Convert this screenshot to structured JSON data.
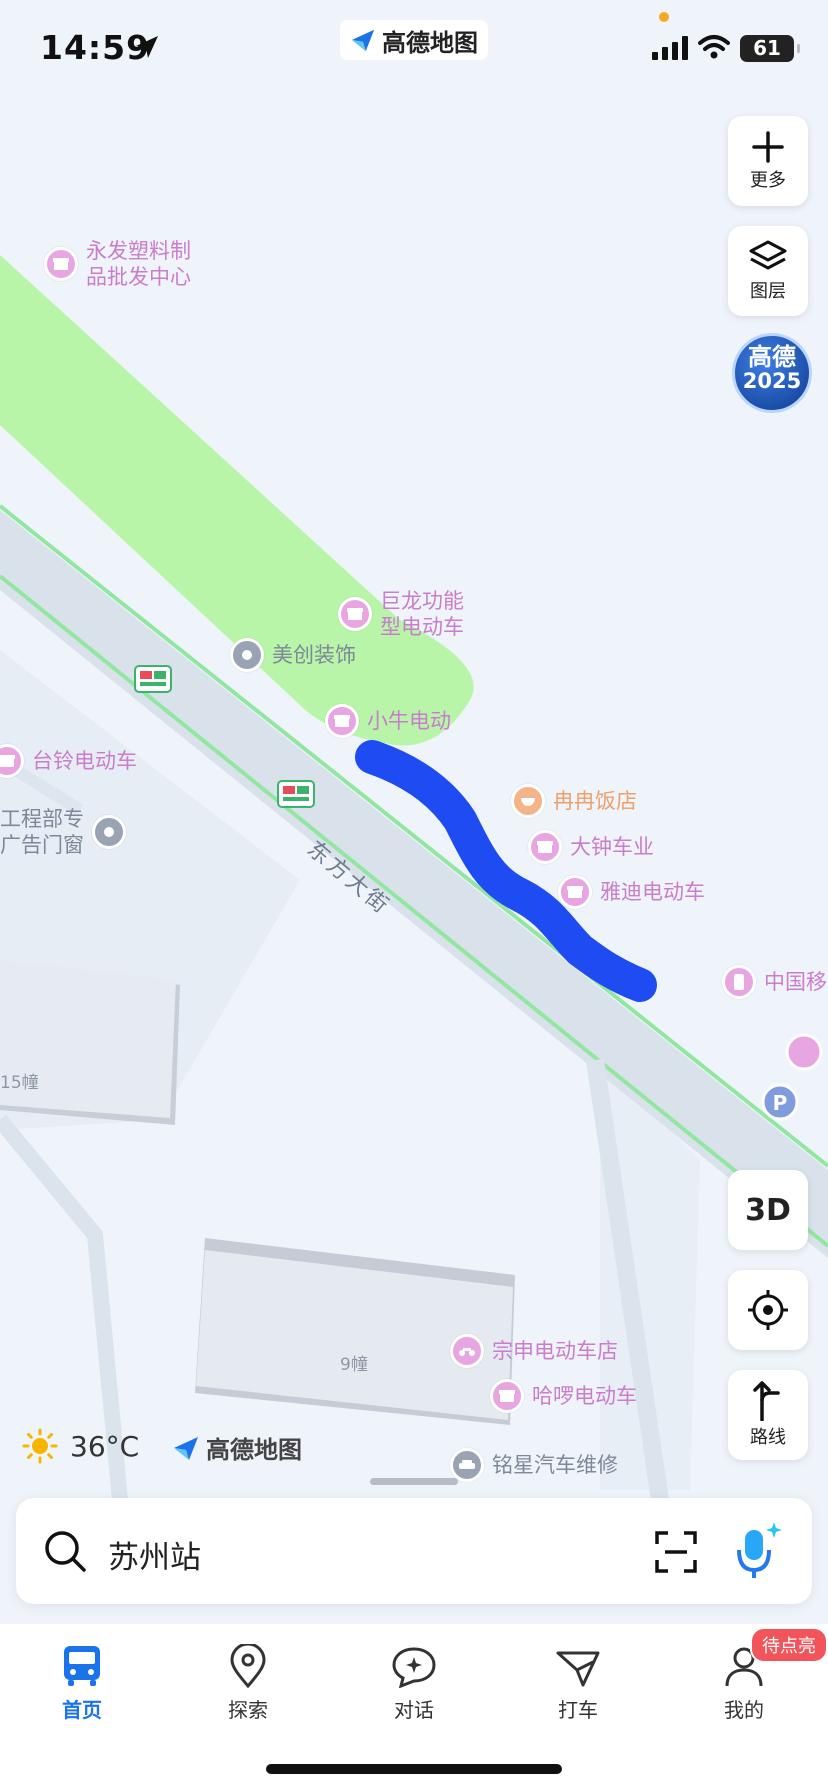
{
  "status_bar": {
    "time": "14:59",
    "battery": "61"
  },
  "header": {
    "brand": "高德地图"
  },
  "map_controls": {
    "more_label": "更多",
    "layers_label": "图层",
    "badge_line1": "高德",
    "badge_line2": "2025",
    "view_3d_label": "3D",
    "route_label": "路线"
  },
  "map": {
    "pois": [
      {
        "id": "yongfa",
        "label": "永发塑料制\n品批发中心",
        "color": "pink",
        "icon": "shop-icon"
      },
      {
        "id": "julong",
        "label": "巨龙功能\n型电动车",
        "color": "pink",
        "icon": "shop-icon"
      },
      {
        "id": "meichuang",
        "label": "美创装饰",
        "color": "slate",
        "icon": "place-icon"
      },
      {
        "id": "xiaoniu",
        "label": "小牛电动",
        "color": "pink",
        "icon": "shop-icon"
      },
      {
        "id": "tailing",
        "label": "台铃电动车",
        "color": "pink",
        "icon": "shop-icon"
      },
      {
        "id": "gongcheng",
        "label": "工程部专\n广告门窗",
        "color": "slate",
        "icon": "place-icon"
      },
      {
        "id": "ranran",
        "label": "冉冉饭店",
        "color": "peach",
        "icon": "restaurant-icon"
      },
      {
        "id": "dazhong",
        "label": "大钟车业",
        "color": "pink",
        "icon": "shop-icon"
      },
      {
        "id": "yadi",
        "label": "雅迪电动车",
        "color": "pink",
        "icon": "shop-icon"
      },
      {
        "id": "zhongguoyi",
        "label": "中国移",
        "color": "pink",
        "icon": "phone-icon"
      },
      {
        "id": "zongshen",
        "label": "宗申电动车店",
        "color": "pink",
        "icon": "motorbike-icon"
      },
      {
        "id": "haluo",
        "label": "哈啰电动车",
        "color": "pink",
        "icon": "shop-icon"
      },
      {
        "id": "mingxing",
        "label": "铭星汽车维修",
        "color": "slate",
        "icon": "car-icon"
      }
    ],
    "road_name": "东方大街",
    "buildings": [
      "15幢",
      "9幢"
    ]
  },
  "weather": {
    "temperature": "36°C"
  },
  "watermark": "高德地图",
  "search": {
    "value": "苏州站"
  },
  "tabs": [
    {
      "label": "首页",
      "icon": "bus-icon",
      "active": true
    },
    {
      "label": "探索",
      "icon": "map-pin-icon",
      "active": false
    },
    {
      "label": "对话",
      "icon": "chat-icon",
      "active": false
    },
    {
      "label": "打车",
      "icon": "taxi-icon",
      "active": false
    },
    {
      "label": "我的",
      "icon": "user-icon",
      "active": false
    }
  ],
  "profile_badge": "待点亮",
  "colors": {
    "accent": "#1a73e8",
    "route": "#1f4cf2",
    "park": "#b8f5a8",
    "road": "#d9e2ea",
    "poi_pink": "#c97dcc"
  }
}
